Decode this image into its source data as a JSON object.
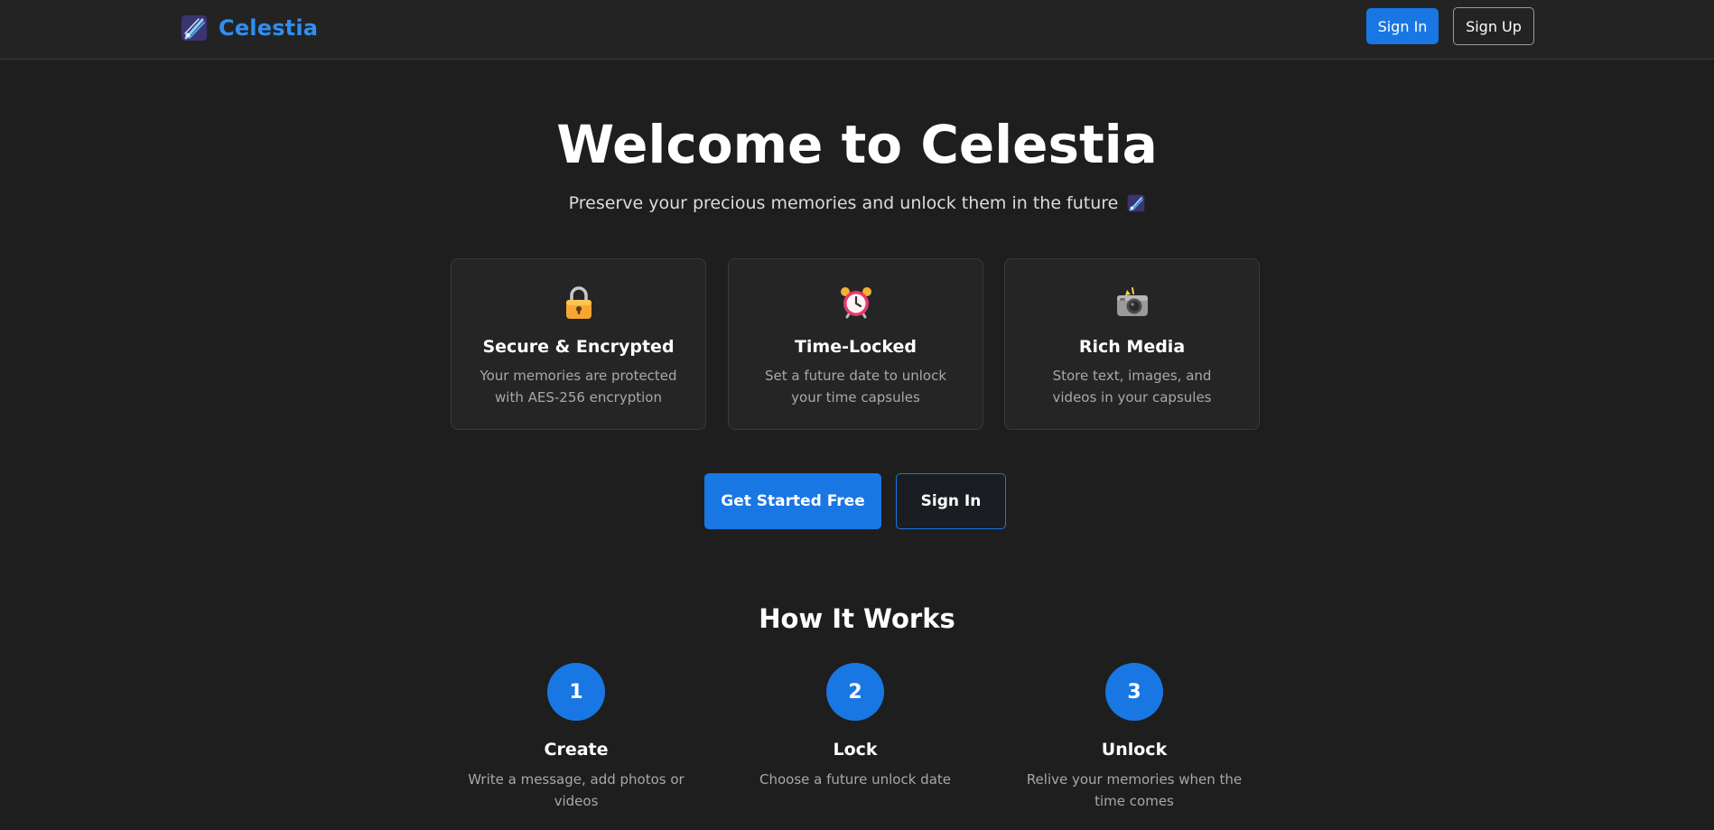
{
  "header": {
    "brand_name": "Celestia",
    "signin_label": "Sign In",
    "signup_label": "Sign Up"
  },
  "hero": {
    "title": "Welcome to Celestia",
    "subtitle": "Preserve your precious memories and unlock them in the future"
  },
  "features": [
    {
      "icon": "lock-icon",
      "title": "Secure & Encrypted",
      "description": "Your memories are protected with AES-256 encryption"
    },
    {
      "icon": "alarm-clock-icon",
      "title": "Time-Locked",
      "description": "Set a future date to unlock your time capsules"
    },
    {
      "icon": "camera-icon",
      "title": "Rich Media",
      "description": "Store text, images, and videos in your capsules"
    }
  ],
  "cta": {
    "primary_label": "Get Started Free",
    "secondary_label": "Sign In"
  },
  "how_it_works": {
    "title": "How It Works",
    "steps": [
      {
        "number": "1",
        "title": "Create",
        "description": "Write a message, add photos or videos"
      },
      {
        "number": "2",
        "title": "Lock",
        "description": "Choose a future unlock date"
      },
      {
        "number": "3",
        "title": "Unlock",
        "description": "Relive your memories when the time comes"
      }
    ]
  },
  "colors": {
    "accent": "#1877e3",
    "brand_text": "#2f8ff0",
    "background": "#1e1e1e",
    "card_background": "#252525"
  }
}
